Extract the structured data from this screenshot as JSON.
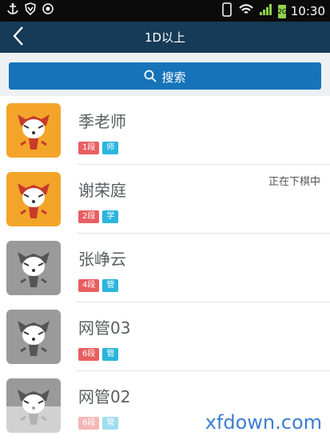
{
  "status_bar": {
    "time": "10:30",
    "sim": "2G"
  },
  "header": {
    "title": "1D以上"
  },
  "search": {
    "label": "搜索"
  },
  "players": [
    {
      "name": "季老师",
      "rank": "1段",
      "role": "师",
      "status": "",
      "avatar_color": "orange"
    },
    {
      "name": "谢荣庭",
      "rank": "2段",
      "role": "学",
      "status": "正在下棋中",
      "avatar_color": "orange"
    },
    {
      "name": "张峥云",
      "rank": "4段",
      "role": "管",
      "status": "",
      "avatar_color": "gray"
    },
    {
      "name": "网管03",
      "rank": "6段",
      "role": "管",
      "status": "",
      "avatar_color": "gray"
    },
    {
      "name": "网管02",
      "rank": "6段",
      "role": "管",
      "status": "",
      "avatar_color": "gray"
    }
  ],
  "watermark": "xfdown.com",
  "colors": {
    "header_bg": "#163b57",
    "search_bg": "#1673b9",
    "rank_badge": "#e85f62",
    "role_badge": "#2bb5dd",
    "avatar_orange": "#f3a52a",
    "avatar_gray": "#9a9a9a"
  }
}
